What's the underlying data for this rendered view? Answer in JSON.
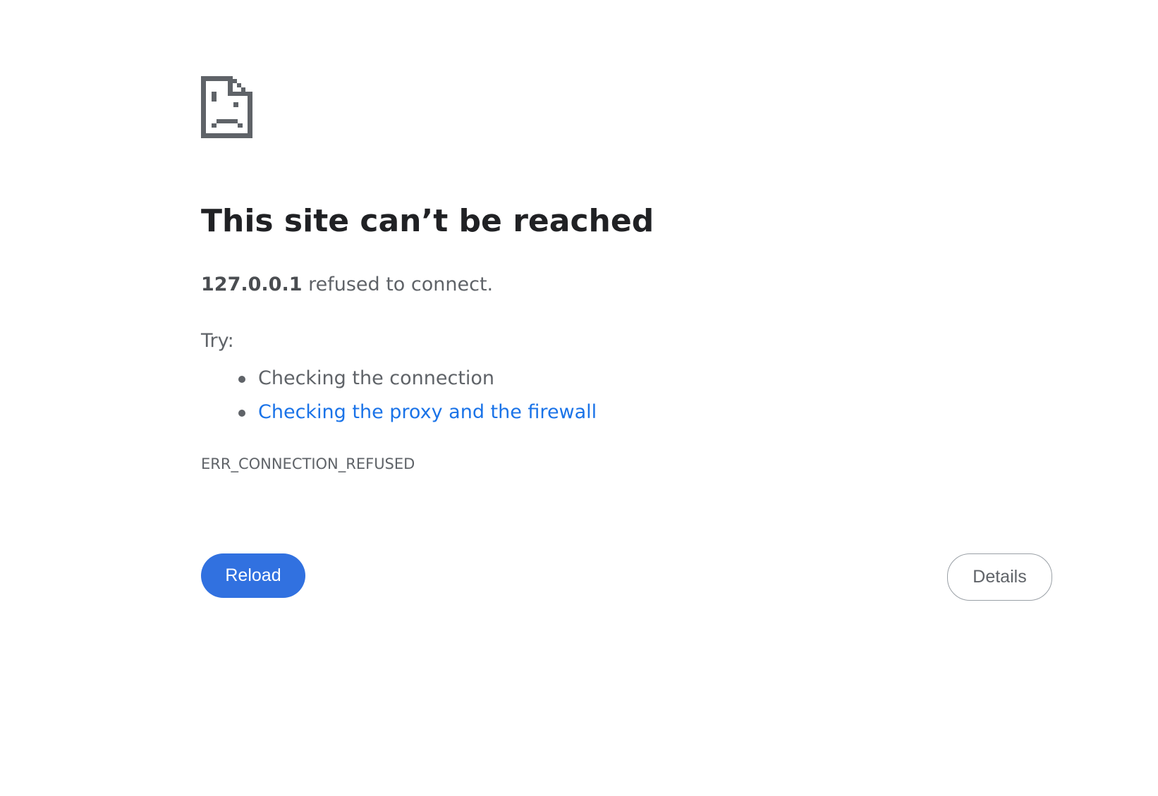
{
  "page": {
    "icon": "sad-page-icon",
    "title": "This site can’t be reached",
    "summary": {
      "host": "127.0.0.1",
      "message": " refused to connect."
    },
    "try_label": "Try:",
    "suggestions": [
      {
        "text": "Checking the connection",
        "is_link": false
      },
      {
        "text": "Checking the proxy and the firewall",
        "is_link": true
      }
    ],
    "error_code": "ERR_CONNECTION_REFUSED",
    "buttons": {
      "reload": "Reload",
      "details": "Details"
    }
  },
  "colors": {
    "title": "#202124",
    "text": "#5f6368",
    "link": "#1a73e8",
    "primary_button": "#3171e0",
    "icon": "#5f6368"
  }
}
